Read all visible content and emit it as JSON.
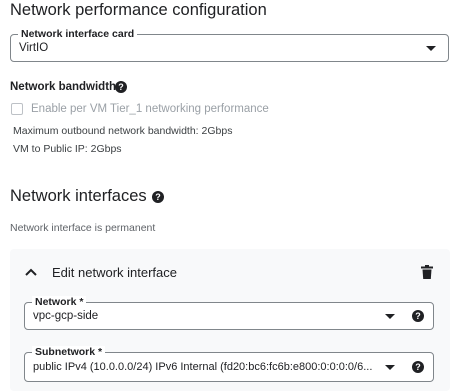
{
  "section_title": "Network performance configuration",
  "nic": {
    "label": "Network interface card",
    "value": "VirtIO"
  },
  "bandwidth": {
    "title": "Network bandwidth",
    "checkbox_label": "Enable per VM Tier_1 networking performance",
    "max_outbound": "Maximum outbound network bandwidth: 2Gbps",
    "public_ip": "VM to Public IP: 2Gbps"
  },
  "interfaces": {
    "title": "Network interfaces",
    "note": "Network interface is permanent",
    "edit_title": "Edit network interface",
    "network": {
      "label": "Network *",
      "value": "vpc-gcp-side"
    },
    "subnetwork": {
      "label": "Subnetwork *",
      "value": "public IPv4 (10.0.0.0/24)  IPv6 Internal (fd20:bc6:fc6b:e800:0:0:0:0/6..."
    }
  },
  "icons": {
    "help": "help-icon",
    "caret": "dropdown-caret-icon",
    "collapse": "chevron-up-icon",
    "delete": "trash-icon"
  }
}
